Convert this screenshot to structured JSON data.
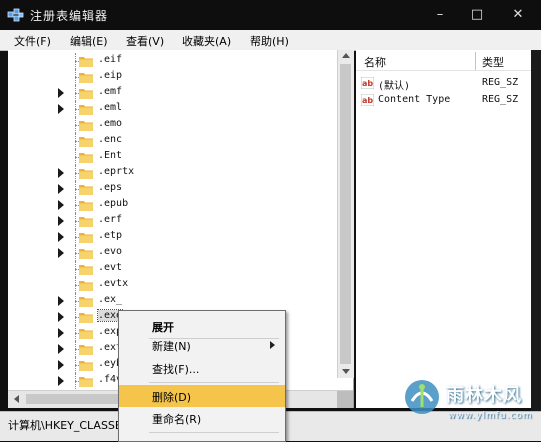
{
  "window": {
    "title": "注册表编辑器",
    "minimize_label": "–",
    "maximize_label": "□",
    "close_label": "✕"
  },
  "menubar": [
    {
      "label": "文件(F)"
    },
    {
      "label": "编辑(E)"
    },
    {
      "label": "查看(V)"
    },
    {
      "label": "收藏夹(A)"
    },
    {
      "label": "帮助(H)"
    }
  ],
  "tree": {
    "items": [
      {
        "label": ".eif",
        "expandable": false
      },
      {
        "label": ".eip",
        "expandable": false
      },
      {
        "label": ".emf",
        "expandable": true
      },
      {
        "label": ".eml",
        "expandable": true
      },
      {
        "label": ".emo",
        "expandable": false
      },
      {
        "label": ".enc",
        "expandable": false
      },
      {
        "label": ".Ent",
        "expandable": false
      },
      {
        "label": ".eprtx",
        "expandable": true
      },
      {
        "label": ".eps",
        "expandable": true
      },
      {
        "label": ".epub",
        "expandable": true
      },
      {
        "label": ".erf",
        "expandable": true
      },
      {
        "label": ".etp",
        "expandable": true
      },
      {
        "label": ".evo",
        "expandable": true
      },
      {
        "label": ".evt",
        "expandable": false
      },
      {
        "label": ".evtx",
        "expandable": false
      },
      {
        "label": ".ex_",
        "expandable": true
      },
      {
        "label": ".exe",
        "expandable": true,
        "selected": true
      },
      {
        "label": ".exp",
        "expandable": true
      },
      {
        "label": ".ext",
        "expandable": true
      },
      {
        "label": ".eyb",
        "expandable": true
      },
      {
        "label": ".f4v",
        "expandable": true
      }
    ]
  },
  "list": {
    "columns": {
      "name": "名称",
      "type": "类型"
    },
    "rows": [
      {
        "name": "(默认)",
        "type": "REG_SZ"
      },
      {
        "name": "Content Type",
        "type": "REG_SZ"
      }
    ]
  },
  "context_menu": {
    "items": [
      {
        "label": "展开",
        "bold": true
      },
      {
        "label": "新建(N)",
        "submenu": true
      },
      {
        "label": "查找(F)..."
      },
      {
        "label": "删除(D)",
        "hover": true
      },
      {
        "label": "重命名(R)"
      }
    ]
  },
  "statusbar": {
    "path": "计算机\\HKEY_CLASSE"
  },
  "watermark": {
    "text": "雨林木风",
    "url": "www.ylmfu.com"
  },
  "colors": {
    "menu_highlight": "#f4c44b",
    "folder": "#e8b73a",
    "ab_icon": "#c0392b"
  }
}
